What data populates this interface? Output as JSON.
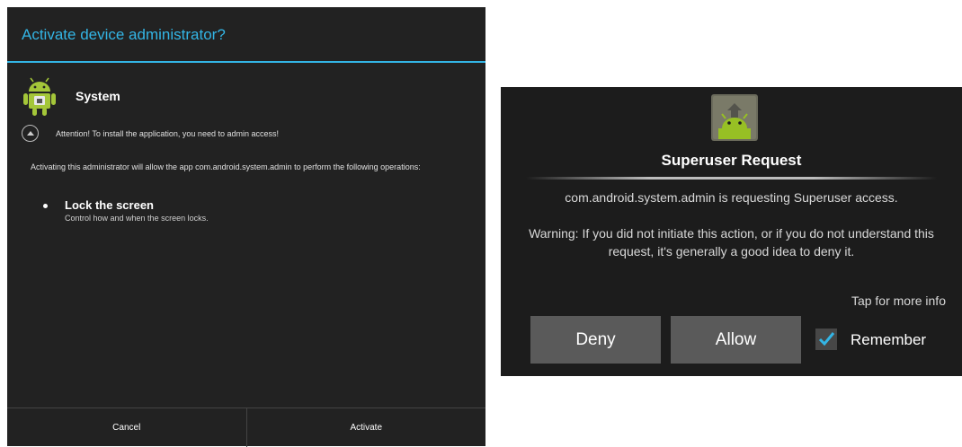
{
  "admin_dialog": {
    "title": "Activate device administrator?",
    "app_name": "System",
    "attention": "Attention! To install the application, you need to admin access!",
    "description": "Activating this administrator will allow the app com.android.system.admin to perform the following operations:",
    "policy_title": "Lock the screen",
    "policy_desc": "Control how and when the screen locks.",
    "cancel_label": "Cancel",
    "activate_label": "Activate",
    "accent_color": "#33b5e5"
  },
  "superuser_dialog": {
    "title": "Superuser Request",
    "request_text": "com.android.system.admin is requesting Superuser access.",
    "warning_text": "Warning: If you did not initiate this action, or if you do not understand this request, it's generally a good idea to deny it.",
    "more_info": "Tap for more info",
    "deny_label": "Deny",
    "allow_label": "Allow",
    "remember_label": "Remember",
    "remember_checked": true,
    "icon": "superuser-android-icon"
  }
}
